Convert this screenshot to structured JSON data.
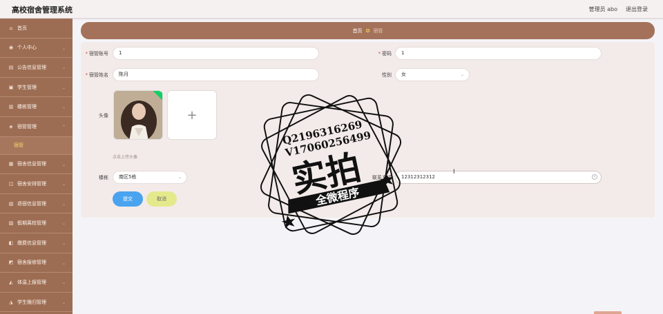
{
  "header": {
    "title": "高校宿舍管理系统",
    "user": "管理员 abo",
    "logout": "退出登录"
  },
  "sidebar": {
    "items": [
      {
        "label": "首页",
        "icon": "home-icon"
      },
      {
        "label": "个人中心",
        "icon": "user-icon"
      },
      {
        "label": "公告信息管理",
        "icon": "notice-icon"
      },
      {
        "label": "学生管理",
        "icon": "student-icon"
      },
      {
        "label": "楼栋管理",
        "icon": "building-icon"
      },
      {
        "label": "宿管管理",
        "icon": "manager-icon"
      },
      {
        "label": "宿舍信息管理",
        "icon": "dorm-icon"
      },
      {
        "label": "宿舍安排管理",
        "icon": "arrange-icon"
      },
      {
        "label": "退宿信息管理",
        "icon": "checkout-icon"
      },
      {
        "label": "假期离校管理",
        "icon": "leave-icon"
      },
      {
        "label": "缴费信息管理",
        "icon": "payment-icon"
      },
      {
        "label": "宿舍报修管理",
        "icon": "repair-icon"
      },
      {
        "label": "体温上报管理",
        "icon": "temperature-icon"
      },
      {
        "label": "学生晚归管理",
        "icon": "late-return-icon"
      }
    ],
    "active_sub": "宿管"
  },
  "breadcrumb": {
    "home": "首页",
    "current": "宿管"
  },
  "form": {
    "account_label": "宿管账号",
    "account_value": "1",
    "password_label": "密码",
    "password_value": "1",
    "name_label": "宿管姓名",
    "name_value": "陈月",
    "gender_label": "性别",
    "gender_value": "女",
    "avatar_label": "头像",
    "upload_hint": "点击上传头像",
    "building_label": "楼栋",
    "building_value": "南区5栋",
    "phone_label": "联系方式",
    "phone_value": "12312312312",
    "submit": "提交",
    "cancel": "取消"
  },
  "watermark": {
    "line1": "Q2196316269",
    "line2": "V17060256499",
    "big": "实拍",
    "ribbon": "全微程序"
  },
  "colors": {
    "sidebar": "#9d6d53",
    "breadcrumb": "#a4725a",
    "active_sub": "#f7d86a",
    "submit": "#4aa3ee",
    "cancel": "#e4ea8c"
  }
}
